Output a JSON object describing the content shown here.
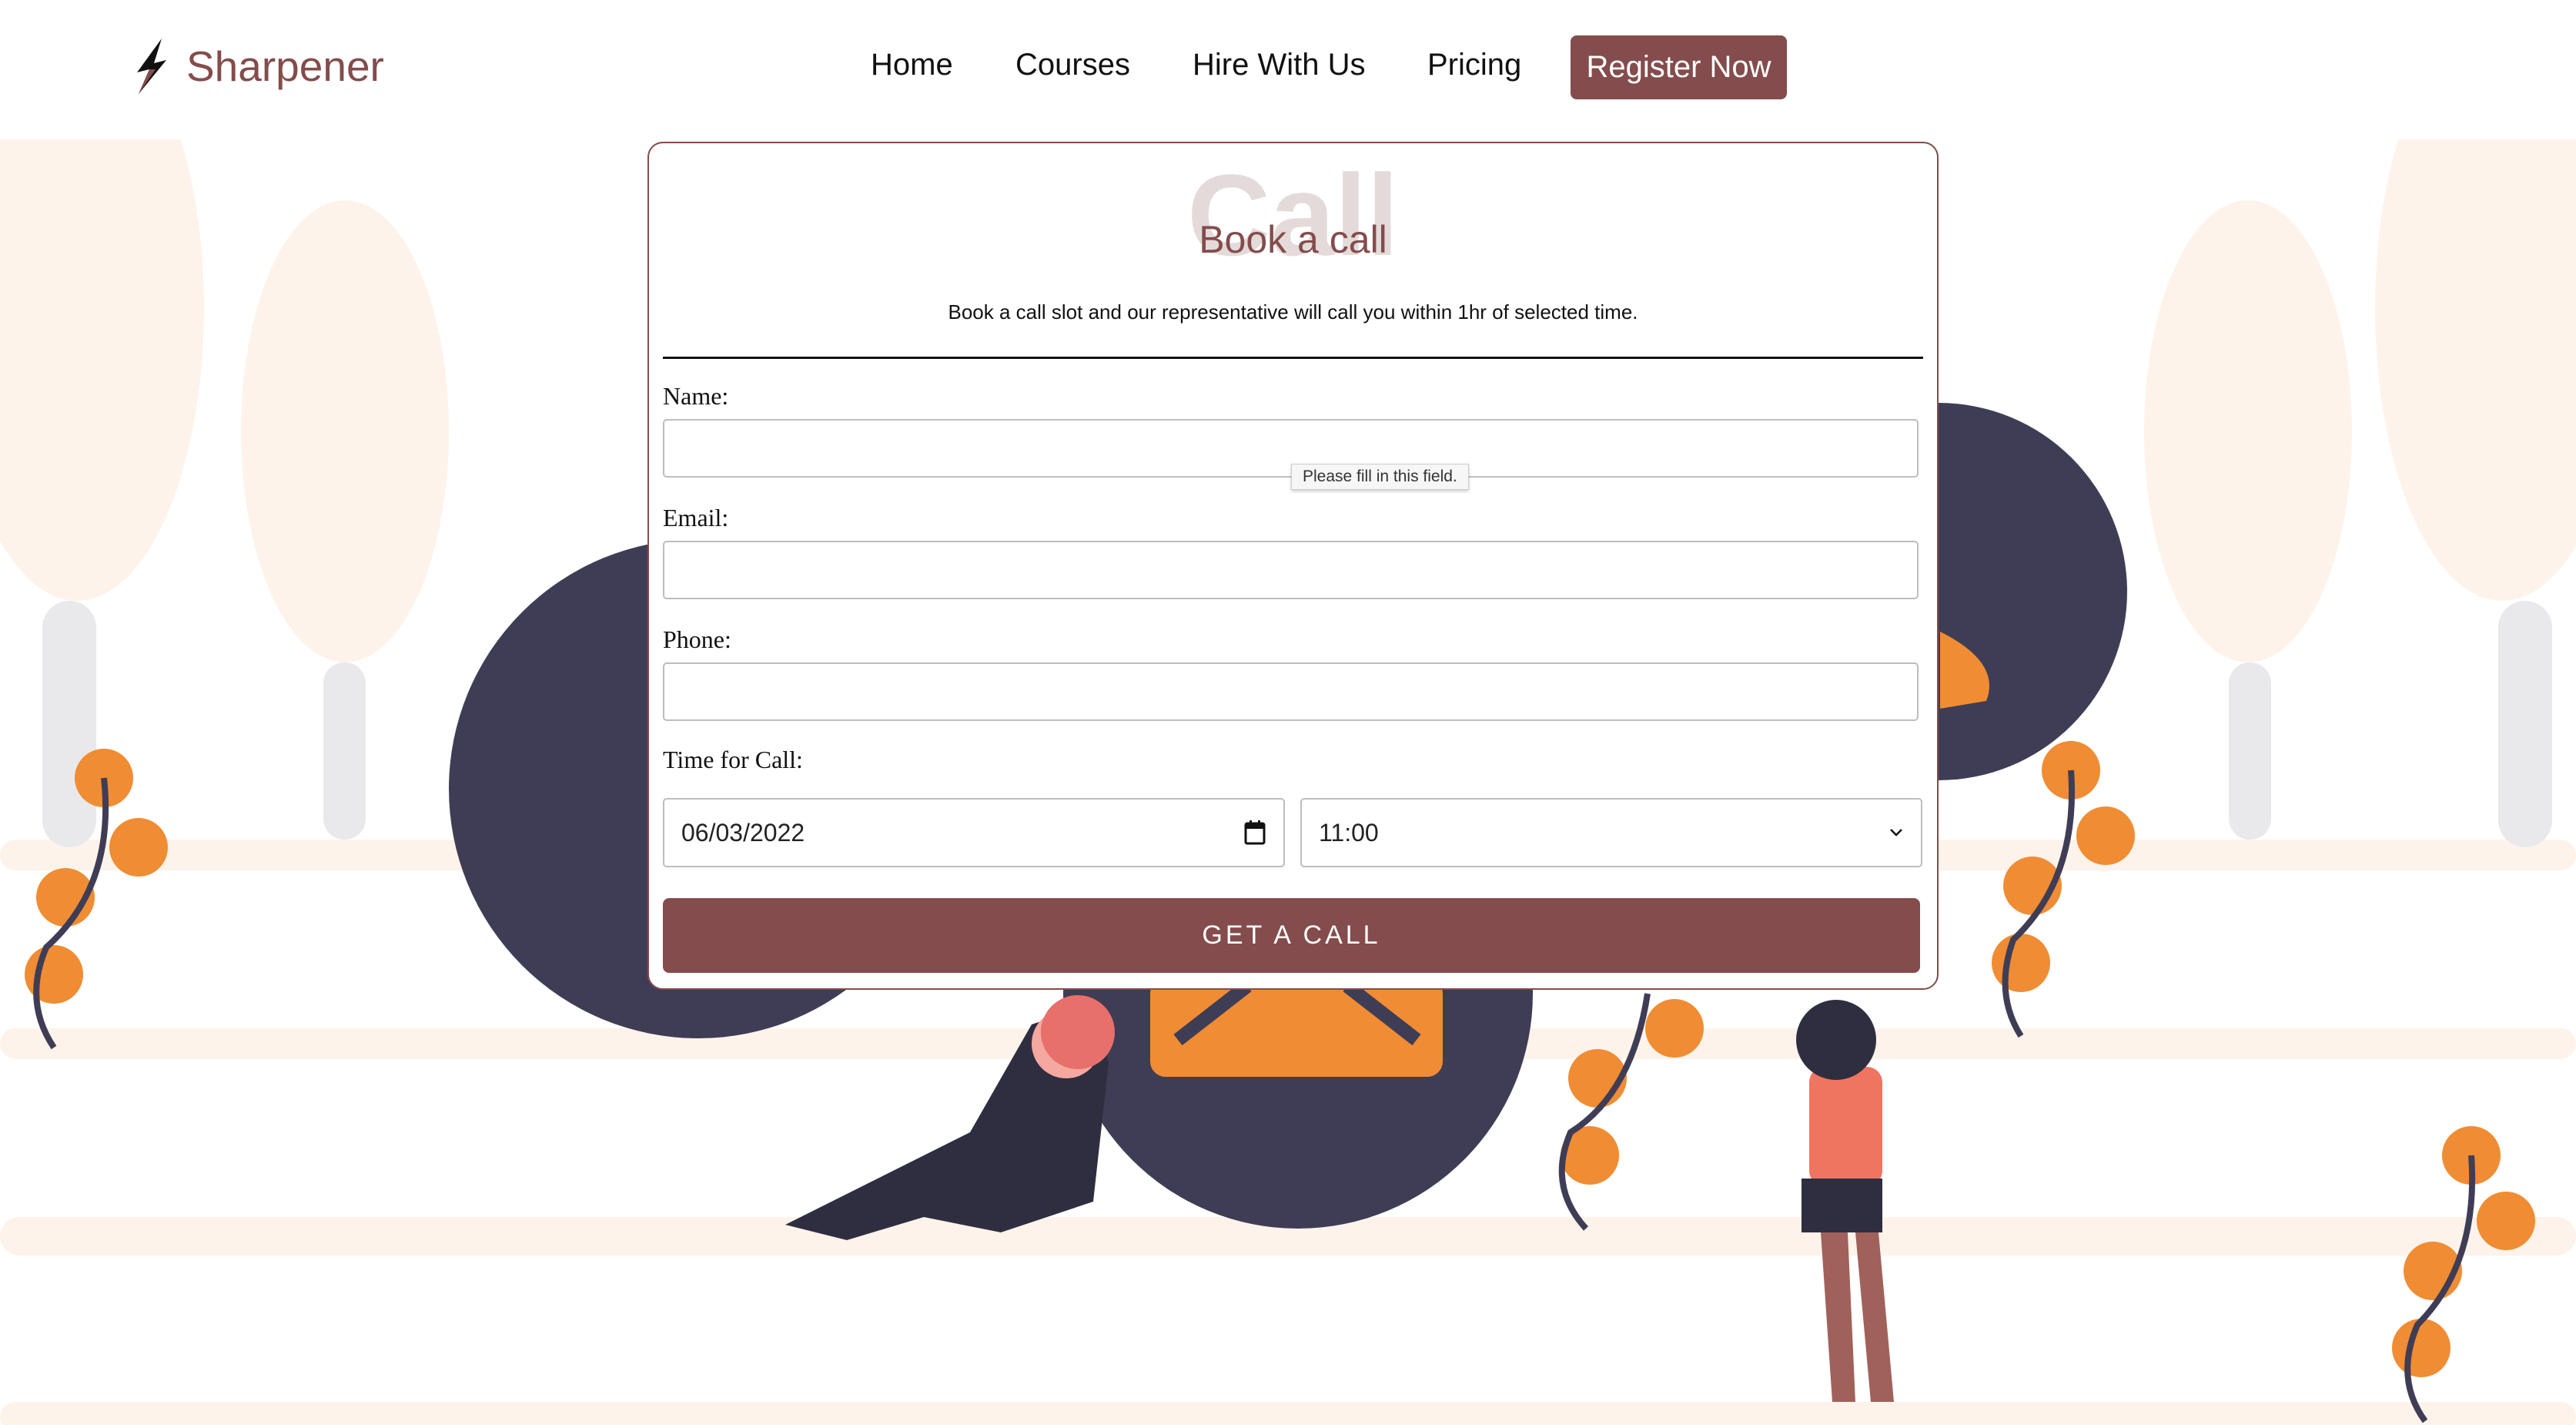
{
  "brand": {
    "name": "Sharpener",
    "accent": "#844c4c"
  },
  "nav": {
    "items": [
      "Home",
      "Courses",
      "Hire With Us",
      "Pricing"
    ],
    "register_label": "Register Now"
  },
  "form": {
    "watermark": "Call",
    "title": "Book a call",
    "subtitle": "Book a call slot and our representative will call you within 1hr of selected time.",
    "name_label": "Name:",
    "email_label": "Email:",
    "phone_label": "Phone:",
    "time_label": "Time for Call:",
    "name_value": "",
    "email_value": "",
    "phone_value": "",
    "date_value": "06/03/2022",
    "time_value": "11:00",
    "validation_tooltip": "Please fill in this field.",
    "submit_label": "GET A CALL"
  }
}
